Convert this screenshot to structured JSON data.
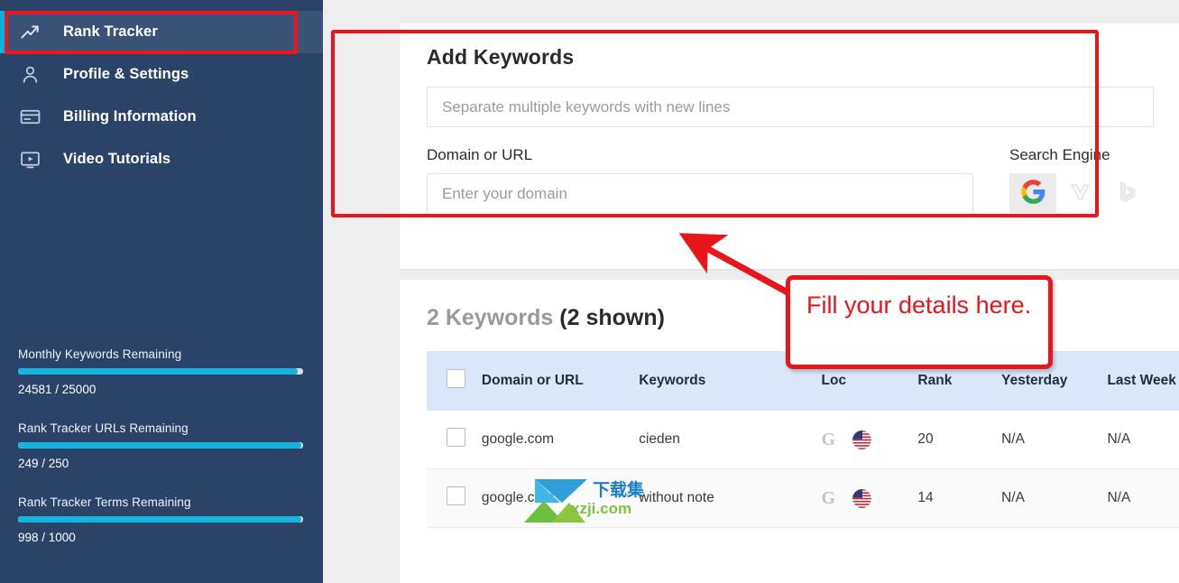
{
  "sidebar": {
    "items": [
      {
        "label": "Rank Tracker",
        "icon": "trending-up-icon",
        "active": true
      },
      {
        "label": "Profile & Settings",
        "icon": "user-icon",
        "active": false
      },
      {
        "label": "Billing Information",
        "icon": "credit-card-icon",
        "active": false
      },
      {
        "label": "Video Tutorials",
        "icon": "video-icon",
        "active": false
      }
    ],
    "meters": [
      {
        "label": "Monthly Keywords Remaining",
        "value": "24581 / 25000",
        "percent": 98
      },
      {
        "label": "Rank Tracker URLs Remaining",
        "value": "249 / 250",
        "percent": 99
      },
      {
        "label": "Rank Tracker Terms Remaining",
        "value": "998 / 1000",
        "percent": 99
      }
    ],
    "bg_color": "#2c4369",
    "active_bg_color": "#3a5278",
    "accent_color": "#00b3e3",
    "meter_fill_color": "#17b4e0"
  },
  "add_keywords": {
    "title": "Add Keywords",
    "keywords_placeholder": "Separate multiple keywords with new lines",
    "keywords_value": "",
    "domain_label": "Domain or URL",
    "domain_placeholder": "Enter your domain",
    "domain_value": "",
    "search_engine_label": "Search Engine",
    "engines": [
      {
        "name": "google-icon",
        "label": "Google",
        "selected": true
      },
      {
        "name": "yahoo-icon",
        "label": "Yahoo",
        "selected": false
      },
      {
        "name": "bing-icon",
        "label": "Bing",
        "selected": false
      }
    ]
  },
  "keywords_panel": {
    "count_text": "2 Keywords",
    "shown_text": "(2 shown)",
    "columns": [
      "",
      "Domain or URL",
      "Keywords",
      "Loc",
      "Rank",
      "Yesterday",
      "Last Week"
    ],
    "rows": [
      {
        "checked": false,
        "domain": "google.com",
        "keyword": "cieden",
        "engine_icon": "google-gray-icon",
        "location_icon": "us-flag-icon",
        "rank": "20",
        "yesterday": "N/A",
        "last_week": "N/A"
      },
      {
        "checked": false,
        "domain": "google.com",
        "keyword": "without note",
        "engine_icon": "google-gray-icon",
        "location_icon": "us-flag-icon",
        "rank": "14",
        "yesterday": "N/A",
        "last_week": "N/A"
      }
    ]
  },
  "annotations": {
    "callout_text": "Fill your details here.",
    "highlight_color": "#e8151a"
  },
  "watermark": {
    "cn_text": "下载集",
    "site_text": "xzji.com"
  }
}
